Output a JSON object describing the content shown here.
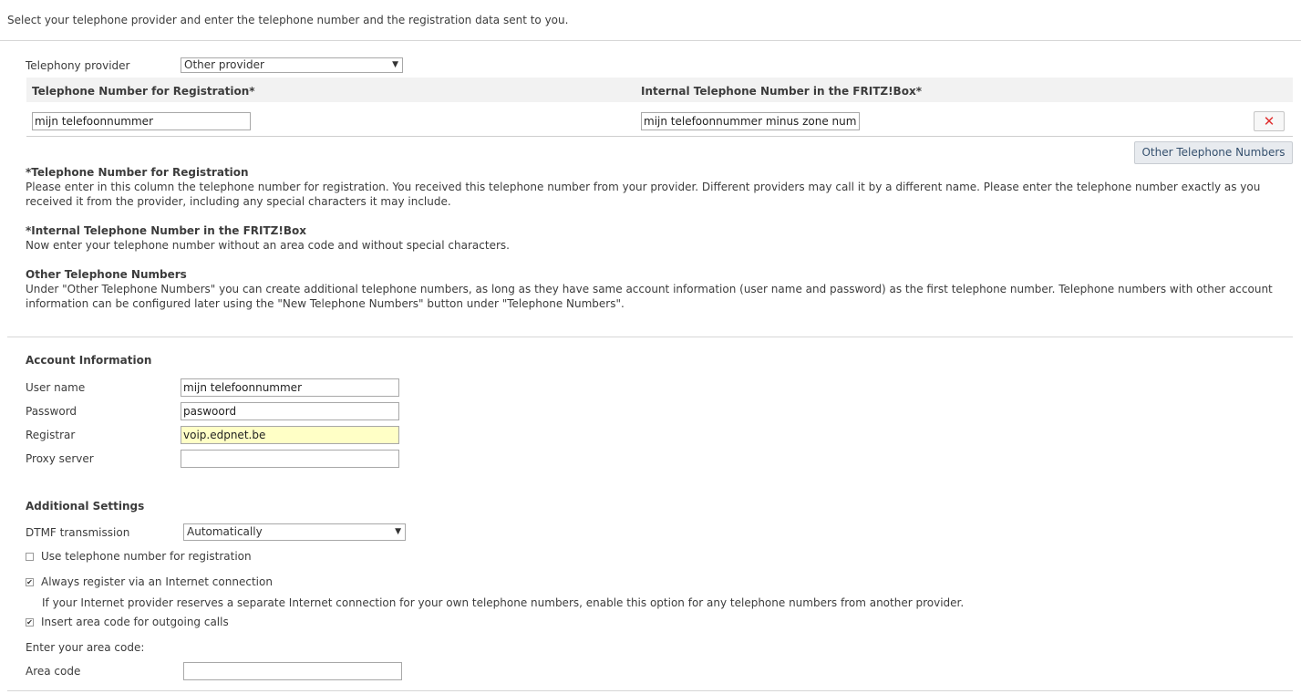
{
  "intro": "Select your telephone provider and enter the telephone number and the registration data sent to you.",
  "provider": {
    "label": "Telephony provider",
    "value": "Other provider"
  },
  "numbers_table": {
    "col_registration": "Telephone Number for Registration*",
    "col_internal": "Internal Telephone Number in the FRITZ!Box*",
    "row": {
      "registration_value": "mijn telefoonnummer",
      "internal_value": "mijn telefoonnummer minus zone nummer"
    },
    "delete_glyph": "✕",
    "other_numbers_button": "Other Telephone Numbers"
  },
  "help": {
    "reg_title": "*Telephone Number for Registration",
    "reg_text": "Please enter in this column the telephone number for registration. You received this telephone number from your provider. Different providers may call it by a different name. Please enter the telephone number exactly as you received it from the provider, including any special characters it may include.",
    "internal_title": "*Internal Telephone Number in the FRITZ!Box",
    "internal_text": "Now enter your telephone number without an area code and without special characters.",
    "other_title": "Other Telephone Numbers",
    "other_text": "Under \"Other Telephone Numbers\" you can create additional telephone numbers, as long as they have same account information (user name and password) as the first telephone number. Telephone numbers with other account information can be configured later using the \"New Telephone Numbers\" button under \"Telephone Numbers\"."
  },
  "account": {
    "heading": "Account Information",
    "username_label": "User name",
    "username_value": "mijn telefoonnummer",
    "password_label": "Password",
    "password_value": "paswoord",
    "registrar_label": "Registrar",
    "registrar_value": "voip.edpnet.be",
    "proxy_label": "Proxy server",
    "proxy_value": ""
  },
  "additional": {
    "heading": "Additional Settings",
    "dtmf_label": "DTMF transmission",
    "dtmf_value": "Automatically",
    "use_number_label": "Use telephone number for registration",
    "use_number_checked": false,
    "always_register_label": "Always register via an Internet connection",
    "always_register_checked": true,
    "always_register_note": "If your Internet provider reserves a separate Internet connection for your own telephone numbers, enable this option for any telephone numbers from another provider.",
    "insert_area_label": "Insert area code for outgoing calls",
    "insert_area_checked": true,
    "enter_area_prompt": "Enter your area code:",
    "area_code_label": "Area code",
    "area_code_value": ""
  },
  "check_glyph": "✔",
  "arrow_glyph": "▼"
}
